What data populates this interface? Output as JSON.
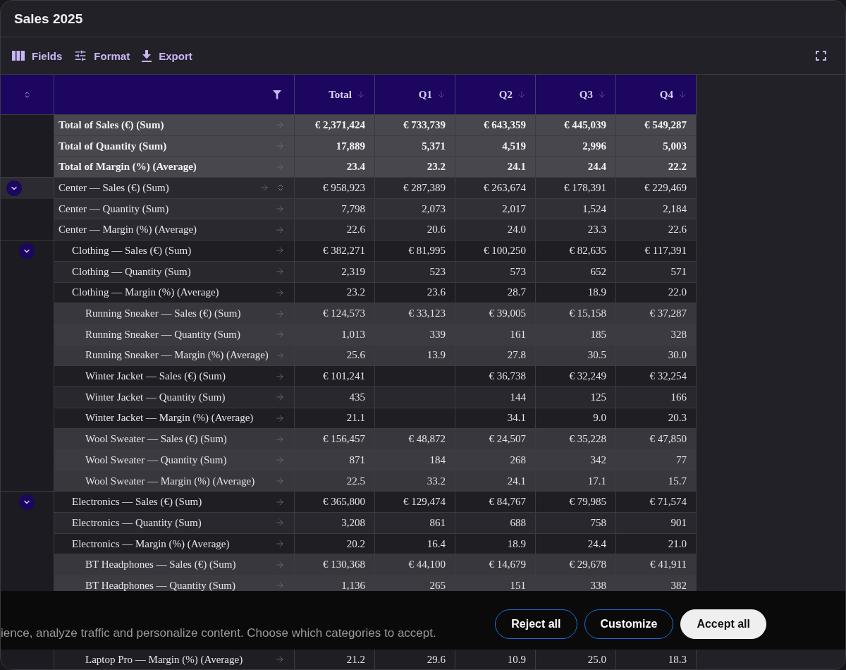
{
  "window": {
    "title": "Sales 2025"
  },
  "toolbar": {
    "actions": [
      {
        "label": "Fields"
      },
      {
        "label": "Format"
      },
      {
        "label": "Export"
      }
    ]
  },
  "table": {
    "columns": [
      {
        "label": "Total"
      },
      {
        "label": "Q1"
      },
      {
        "label": "Q2"
      },
      {
        "label": "Q3"
      },
      {
        "label": "Q4"
      }
    ],
    "totals": [
      {
        "label": "Total of Sales (€) (Sum)",
        "values": {
          "total": "€ 2,371,424",
          "q1": "€ 733,739",
          "q2": "€ 643,359",
          "q3": "€ 445,039",
          "q4": "€ 549,287"
        }
      },
      {
        "label": "Total of Quantity (Sum)",
        "values": {
          "total": "17,889",
          "q1": "5,371",
          "q2": "4,519",
          "q3": "2,996",
          "q4": "5,003"
        }
      },
      {
        "label": "Total of Margin (%) (Average)",
        "values": {
          "total": "23.4",
          "q1": "23.2",
          "q2": "24.1",
          "q3": "24.4",
          "q4": "22.2"
        }
      }
    ],
    "groups": [
      {
        "kind": "branch",
        "expanded": true,
        "rows": [
          {
            "label": "Center — Sales (€) (Sum)",
            "hovered": true,
            "values": {
              "total": "€ 958,923",
              "q1": "€ 287,389",
              "q2": "€ 263,674",
              "q3": "€ 178,391",
              "q4": "€ 229,469"
            }
          },
          {
            "label": "Center — Quantity (Sum)",
            "hovered": false,
            "values": {
              "total": "7,798",
              "q1": "2,073",
              "q2": "2,017",
              "q3": "1,524",
              "q4": "2,184"
            }
          },
          {
            "label": "Center — Margin (%) (Average)",
            "hovered": false,
            "values": {
              "total": "22.6",
              "q1": "20.6",
              "q2": "24.0",
              "q3": "23.3",
              "q4": "22.6"
            }
          }
        ],
        "children": [
          {
            "kind": "branch",
            "expanded": true,
            "rows": [
              {
                "label": "Clothing — Sales (€) (Sum)",
                "hovered": false,
                "values": {
                  "total": "€ 382,271",
                  "q1": "€ 81,995",
                  "q2": "€ 100,250",
                  "q3": "€ 82,635",
                  "q4": "€ 117,391"
                }
              },
              {
                "label": "Clothing — Quantity (Sum)",
                "hovered": false,
                "values": {
                  "total": "2,319",
                  "q1": "523",
                  "q2": "573",
                  "q3": "652",
                  "q4": "571"
                }
              },
              {
                "label": "Clothing — Margin (%) (Average)",
                "hovered": false,
                "values": {
                  "total": "23.2",
                  "q1": "23.6",
                  "q2": "28.7",
                  "q3": "18.9",
                  "q4": "22.0"
                }
              }
            ],
            "children": [
              {
                "kind": "leaf",
                "rows": [
                  {
                    "label": "Running Sneaker — Sales (€) (Sum)",
                    "hovered": false,
                    "values": {
                      "total": "€ 124,573",
                      "q1": "€ 33,123",
                      "q2": "€ 39,005",
                      "q3": "€ 15,158",
                      "q4": "€ 37,287"
                    }
                  },
                  {
                    "label": "Running Sneaker — Quantity (Sum)",
                    "hovered": false,
                    "values": {
                      "total": "1,013",
                      "q1": "339",
                      "q2": "161",
                      "q3": "185",
                      "q4": "328"
                    }
                  },
                  {
                    "label": "Running Sneaker — Margin (%) (Average)",
                    "hovered": false,
                    "values": {
                      "total": "25.6",
                      "q1": "13.9",
                      "q2": "27.8",
                      "q3": "30.5",
                      "q4": "30.0"
                    }
                  }
                ]
              },
              {
                "kind": "leaf",
                "rows": [
                  {
                    "label": "Winter Jacket — Sales (€) (Sum)",
                    "hovered": false,
                    "values": {
                      "total": "€ 101,241",
                      "q2": "€ 36,738",
                      "q3": "€ 32,249",
                      "q4": "€ 32,254"
                    }
                  },
                  {
                    "label": "Winter Jacket — Quantity (Sum)",
                    "hovered": false,
                    "values": {
                      "total": "435",
                      "q2": "144",
                      "q3": "125",
                      "q4": "166"
                    }
                  },
                  {
                    "label": "Winter Jacket — Margin (%) (Average)",
                    "hovered": false,
                    "values": {
                      "total": "21.1",
                      "q2": "34.1",
                      "q3": "9.0",
                      "q4": "20.3"
                    }
                  }
                ]
              },
              {
                "kind": "leaf",
                "rows": [
                  {
                    "label": "Wool Sweater — Sales (€) (Sum)",
                    "hovered": false,
                    "values": {
                      "total": "€ 156,457",
                      "q1": "€ 48,872",
                      "q2": "€ 24,507",
                      "q3": "€ 35,228",
                      "q4": "€ 47,850"
                    }
                  },
                  {
                    "label": "Wool Sweater — Quantity (Sum)",
                    "hovered": false,
                    "values": {
                      "total": "871",
                      "q1": "184",
                      "q2": "268",
                      "q3": "342",
                      "q4": "77"
                    }
                  },
                  {
                    "label": "Wool Sweater — Margin (%) (Average)",
                    "hovered": false,
                    "values": {
                      "total": "22.5",
                      "q1": "33.2",
                      "q2": "24.1",
                      "q3": "17.1",
                      "q4": "15.7"
                    }
                  }
                ]
              }
            ]
          },
          {
            "kind": "branch",
            "expanded": true,
            "rows": [
              {
                "label": "Electronics — Sales (€) (Sum)",
                "hovered": false,
                "values": {
                  "total": "€ 365,800",
                  "q1": "€ 129,474",
                  "q2": "€ 84,767",
                  "q3": "€ 79,985",
                  "q4": "€ 71,574"
                }
              },
              {
                "label": "Electronics — Quantity (Sum)",
                "hovered": false,
                "values": {
                  "total": "3,208",
                  "q1": "861",
                  "q2": "688",
                  "q3": "758",
                  "q4": "901"
                }
              },
              {
                "label": "Electronics — Margin (%) (Average)",
                "hovered": false,
                "values": {
                  "total": "20.2",
                  "q1": "16.4",
                  "q2": "18.9",
                  "q3": "24.4",
                  "q4": "21.0"
                }
              }
            ],
            "children": [
              {
                "kind": "leaf",
                "rows": [
                  {
                    "label": "BT Headphones — Sales (€) (Sum)",
                    "hovered": false,
                    "values": {
                      "total": "€ 130,368",
                      "q1": "€ 44,100",
                      "q2": "€ 14,679",
                      "q3": "€ 29,678",
                      "q4": "€ 41,911"
                    }
                  },
                  {
                    "label": "BT Headphones — Quantity (Sum)",
                    "hovered": false,
                    "values": {
                      "total": "1,136",
                      "q1": "265",
                      "q2": "151",
                      "q3": "338",
                      "q4": "382"
                    }
                  }
                ]
              },
              {
                "kind": "leaf",
                "rows": [
                  {
                    "label": "Laptop Pro — Margin (%) (Average)",
                    "hovered": false,
                    "values": {
                      "total": "21.2",
                      "q1": "29.6",
                      "q2": "10.9",
                      "q3": "25.0",
                      "q4": "18.3"
                    }
                  }
                ]
              }
            ]
          }
        ]
      }
    ]
  },
  "cookie_banner": {
    "text": "ience, analyze traffic and personalize content. Choose which categories to accept.",
    "buttons": [
      {
        "label": "Reject all",
        "kind": "outline"
      },
      {
        "label": "Customize",
        "kind": "outline"
      },
      {
        "label": "Accept all",
        "kind": "filled"
      }
    ]
  }
}
